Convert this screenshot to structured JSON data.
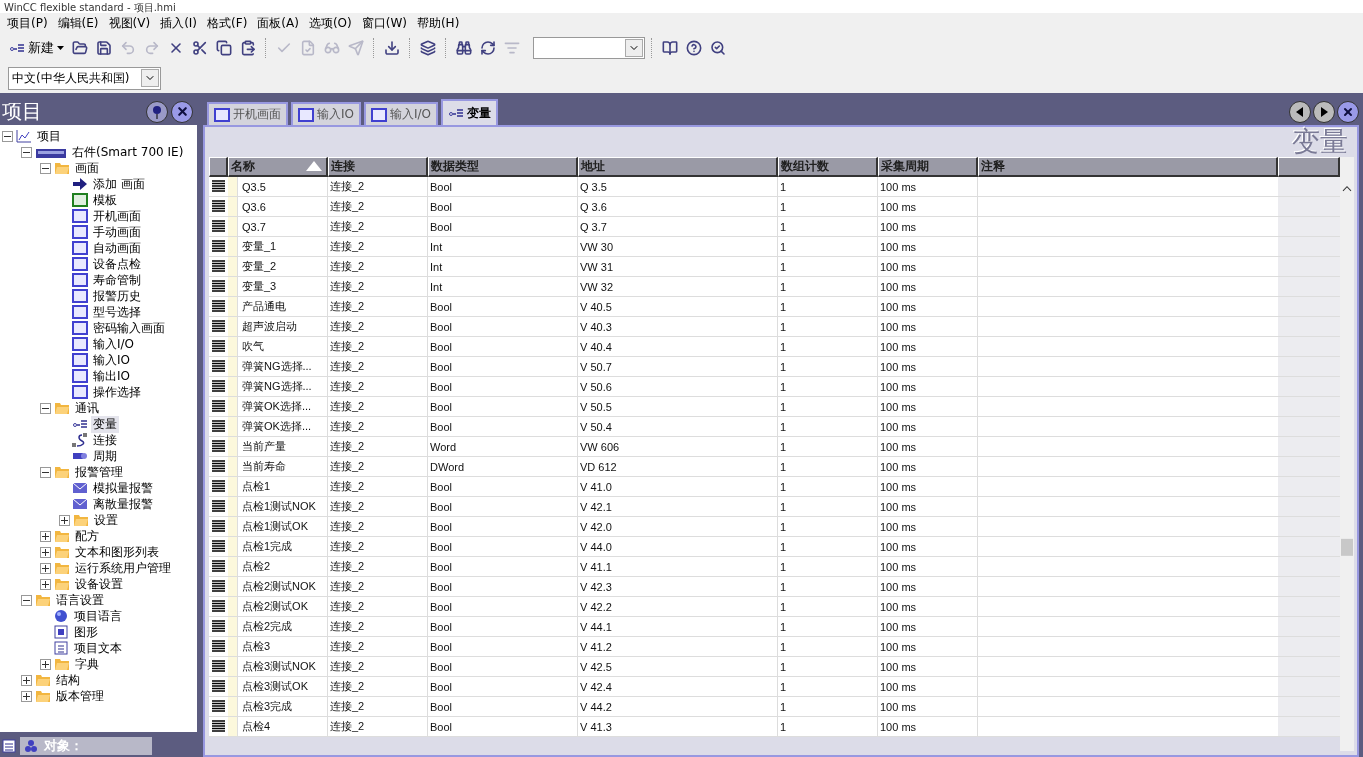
{
  "window": {
    "title": "WinCC flexible standard - 项目.hmi"
  },
  "menu": [
    "项目(P)",
    "编辑(E)",
    "视图(V)",
    "插入(I)",
    "格式(F)",
    "面板(A)",
    "选项(O)",
    "窗口(W)",
    "帮助(H)"
  ],
  "toolbar": [
    {
      "kind": "new",
      "label": "新建"
    },
    {
      "kind": "open",
      "disabled": false
    },
    {
      "kind": "save",
      "disabled": false
    },
    {
      "kind": "undo",
      "disabled": true
    },
    {
      "kind": "redo",
      "disabled": true
    },
    {
      "kind": "delete",
      "disabled": false
    },
    {
      "kind": "cut",
      "disabled": false
    },
    {
      "kind": "copy",
      "disabled": false
    },
    {
      "kind": "paste",
      "disabled": false
    },
    {
      "kind": "sep"
    },
    {
      "kind": "check",
      "disabled": true
    },
    {
      "kind": "compile",
      "disabled": true
    },
    {
      "kind": "simulate",
      "disabled": true
    },
    {
      "kind": "transfer",
      "disabled": true
    },
    {
      "kind": "sep"
    },
    {
      "kind": "download",
      "disabled": false
    },
    {
      "kind": "sep"
    },
    {
      "kind": "layers",
      "disabled": false
    },
    {
      "kind": "sep"
    },
    {
      "kind": "find",
      "disabled": false
    },
    {
      "kind": "refresh",
      "disabled": false
    },
    {
      "kind": "crossref",
      "disabled": true
    },
    {
      "kind": "combo"
    },
    {
      "kind": "sep"
    },
    {
      "kind": "book",
      "disabled": false
    },
    {
      "kind": "help",
      "disabled": false
    },
    {
      "kind": "whatsthis",
      "disabled": false
    }
  ],
  "language": {
    "value": "中文(中华人民共和国)"
  },
  "project_panel": {
    "title": "项目",
    "tree": [
      {
        "label": "项目",
        "kind": "project",
        "selected": false,
        "expanded": true,
        "children": [
          {
            "label": "右件(Smart 700 IE)",
            "kind": "device",
            "selected": false,
            "expanded": true,
            "children": [
              {
                "label": "画面",
                "kind": "folder",
                "selected": false,
                "expanded": true,
                "children": [
                  {
                    "label": "添加 画面",
                    "kind": "add",
                    "selected": false
                  },
                  {
                    "label": "模板",
                    "kind": "template",
                    "selected": false
                  },
                  {
                    "label": "开机画面",
                    "kind": "screen",
                    "selected": false
                  },
                  {
                    "label": "手动画面",
                    "kind": "screen",
                    "selected": false
                  },
                  {
                    "label": "自动画面",
                    "kind": "screen",
                    "selected": false
                  },
                  {
                    "label": "设备点检",
                    "kind": "screen",
                    "selected": false
                  },
                  {
                    "label": "寿命管制",
                    "kind": "screen",
                    "selected": false
                  },
                  {
                    "label": "报警历史",
                    "kind": "screen",
                    "selected": false
                  },
                  {
                    "label": "型号选择",
                    "kind": "screen",
                    "selected": false
                  },
                  {
                    "label": "密码输入画面",
                    "kind": "screen",
                    "selected": false
                  },
                  {
                    "label": "输入I/O",
                    "kind": "screen",
                    "selected": false
                  },
                  {
                    "label": "输入IO",
                    "kind": "screen",
                    "selected": false
                  },
                  {
                    "label": "输出IO",
                    "kind": "screen",
                    "selected": false
                  },
                  {
                    "label": "操作选择",
                    "kind": "screen",
                    "selected": false
                  }
                ]
              },
              {
                "label": "通讯",
                "kind": "folder",
                "selected": false,
                "expanded": true,
                "children": [
                  {
                    "label": "变量",
                    "kind": "tags",
                    "selected": true
                  },
                  {
                    "label": "连接",
                    "kind": "connection",
                    "selected": false
                  },
                  {
                    "label": "周期",
                    "kind": "cycle",
                    "selected": false
                  }
                ]
              },
              {
                "label": "报警管理",
                "kind": "folder",
                "selected": false,
                "expanded": true,
                "children": [
                  {
                    "label": "模拟量报警",
                    "kind": "alarm",
                    "selected": false
                  },
                  {
                    "label": "离散量报警",
                    "kind": "alarm",
                    "selected": false
                  },
                  {
                    "label": "设置",
                    "kind": "folder",
                    "selected": false,
                    "expanded": false
                  }
                ]
              },
              {
                "label": "配方",
                "kind": "folder",
                "selected": false,
                "expanded": false
              },
              {
                "label": "文本和图形列表",
                "kind": "folder",
                "selected": false,
                "expanded": false
              },
              {
                "label": "运行系统用户管理",
                "kind": "folder",
                "selected": false,
                "expanded": false
              },
              {
                "label": "设备设置",
                "kind": "folder",
                "selected": false,
                "expanded": false
              }
            ]
          },
          {
            "label": "语言设置",
            "kind": "folder",
            "selected": false,
            "expanded": true,
            "children": [
              {
                "label": "项目语言",
                "kind": "globe",
                "selected": false
              },
              {
                "label": "图形",
                "kind": "graphic",
                "selected": false
              },
              {
                "label": "项目文本",
                "kind": "text",
                "selected": false
              },
              {
                "label": "字典",
                "kind": "folder",
                "selected": false,
                "expanded": false
              }
            ]
          },
          {
            "label": "结构",
            "kind": "folder",
            "selected": false,
            "expanded": false
          },
          {
            "label": "版本管理",
            "kind": "folder",
            "selected": false,
            "expanded": false
          }
        ]
      }
    ]
  },
  "object_bar": {
    "label": "对象："
  },
  "tabs": [
    {
      "label": "开机画面",
      "kind": "screen",
      "selected": false
    },
    {
      "label": "输入IO",
      "kind": "screen",
      "selected": false
    },
    {
      "label": "输入I/O",
      "kind": "screen",
      "selected": false
    },
    {
      "label": "变量",
      "kind": "tags",
      "selected": true
    }
  ],
  "editor_title": "变量",
  "table": {
    "columns": [
      "名称",
      "连接",
      "数据类型",
      "地址",
      "数组计数",
      "采集周期",
      "注释"
    ],
    "rows": [
      [
        "Q3.5",
        "连接_2",
        "Bool",
        "Q 3.5",
        "1",
        "100 ms"
      ],
      [
        "Q3.6",
        "连接_2",
        "Bool",
        "Q 3.6",
        "1",
        "100 ms"
      ],
      [
        "Q3.7",
        "连接_2",
        "Bool",
        "Q 3.7",
        "1",
        "100 ms"
      ],
      [
        "变量_1",
        "连接_2",
        "Int",
        "VW 30",
        "1",
        "100 ms"
      ],
      [
        "变量_2",
        "连接_2",
        "Int",
        "VW 31",
        "1",
        "100 ms"
      ],
      [
        "变量_3",
        "连接_2",
        "Int",
        "VW 32",
        "1",
        "100 ms"
      ],
      [
        "产品通电",
        "连接_2",
        "Bool",
        "V 40.5",
        "1",
        "100 ms"
      ],
      [
        "超声波启动",
        "连接_2",
        "Bool",
        "V 40.3",
        "1",
        "100 ms"
      ],
      [
        "吹气",
        "连接_2",
        "Bool",
        "V 40.4",
        "1",
        "100 ms"
      ],
      [
        "弹簧NG选择...",
        "连接_2",
        "Bool",
        "V 50.7",
        "1",
        "100 ms"
      ],
      [
        "弹簧NG选择...",
        "连接_2",
        "Bool",
        "V 50.6",
        "1",
        "100 ms"
      ],
      [
        "弹簧OK选择...",
        "连接_2",
        "Bool",
        "V 50.5",
        "1",
        "100 ms"
      ],
      [
        "弹簧OK选择...",
        "连接_2",
        "Bool",
        "V 50.4",
        "1",
        "100 ms"
      ],
      [
        "当前产量",
        "连接_2",
        "Word",
        "VW 606",
        "1",
        "100 ms"
      ],
      [
        "当前寿命",
        "连接_2",
        "DWord",
        "VD 612",
        "1",
        "100 ms"
      ],
      [
        "点检1",
        "连接_2",
        "Bool",
        "V 41.0",
        "1",
        "100 ms"
      ],
      [
        "点检1测试NOK",
        "连接_2",
        "Bool",
        "V 42.1",
        "1",
        "100 ms"
      ],
      [
        "点检1测试OK",
        "连接_2",
        "Bool",
        "V 42.0",
        "1",
        "100 ms"
      ],
      [
        "点检1完成",
        "连接_2",
        "Bool",
        "V 44.0",
        "1",
        "100 ms"
      ],
      [
        "点检2",
        "连接_2",
        "Bool",
        "V 41.1",
        "1",
        "100 ms"
      ],
      [
        "点检2测试NOK",
        "连接_2",
        "Bool",
        "V 42.3",
        "1",
        "100 ms"
      ],
      [
        "点检2测试OK",
        "连接_2",
        "Bool",
        "V 42.2",
        "1",
        "100 ms"
      ],
      [
        "点检2完成",
        "连接_2",
        "Bool",
        "V 44.1",
        "1",
        "100 ms"
      ],
      [
        "点检3",
        "连接_2",
        "Bool",
        "V 41.2",
        "1",
        "100 ms"
      ],
      [
        "点检3测试NOK",
        "连接_2",
        "Bool",
        "V 42.5",
        "1",
        "100 ms"
      ],
      [
        "点检3测试OK",
        "连接_2",
        "Bool",
        "V 42.4",
        "1",
        "100 ms"
      ],
      [
        "点检3完成",
        "连接_2",
        "Bool",
        "V 44.2",
        "1",
        "100 ms"
      ],
      [
        "点检4",
        "连接_2",
        "Bool",
        "V 41.3",
        "1",
        "100 ms"
      ]
    ]
  }
}
